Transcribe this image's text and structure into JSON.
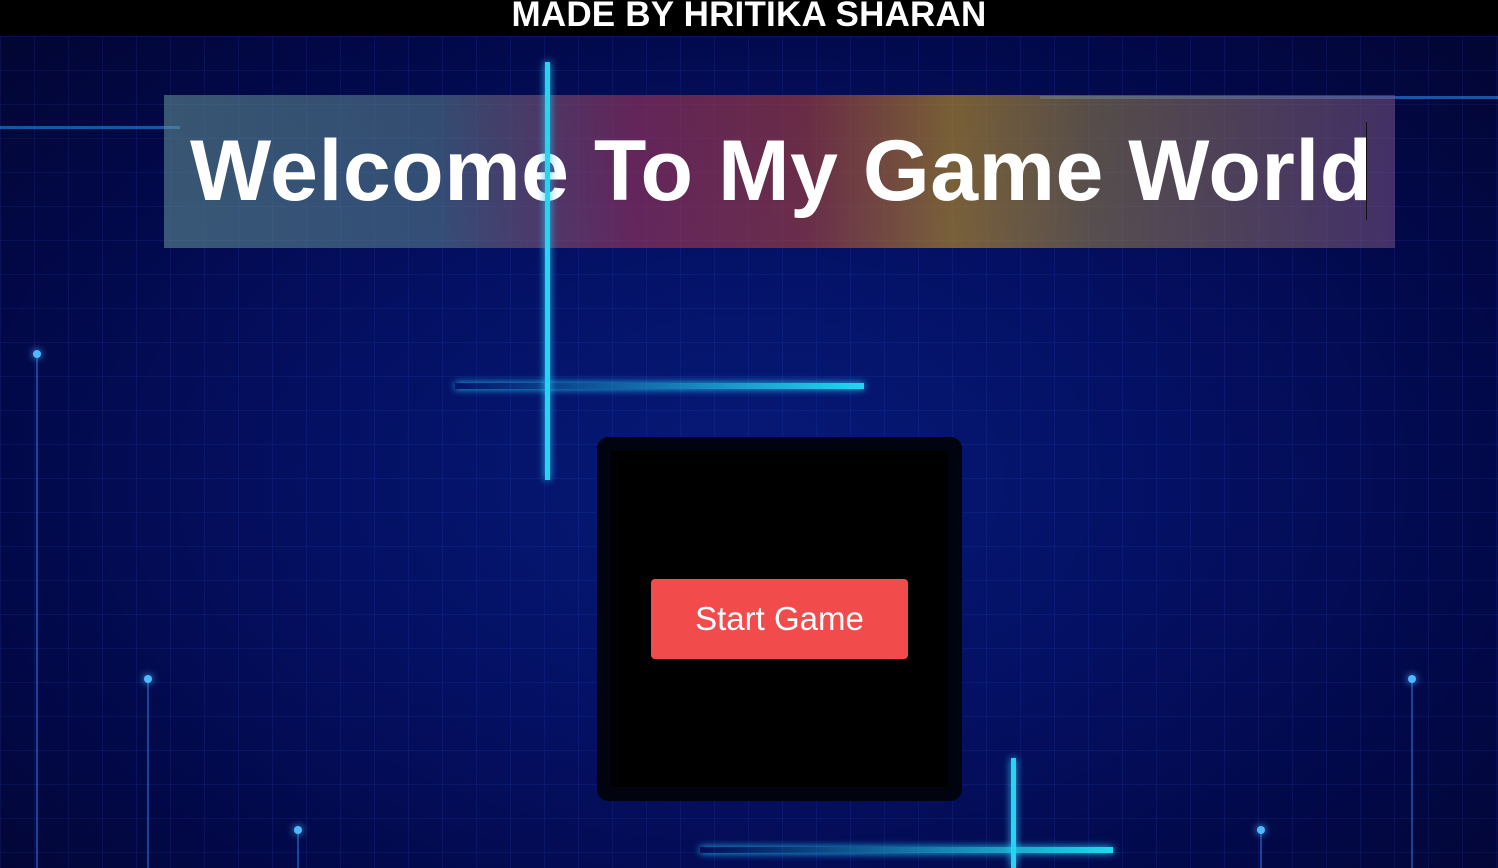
{
  "banner": {
    "text": "MADE BY HRITIKA SHARAN"
  },
  "title": {
    "text": "Welcome To My Game World"
  },
  "game": {
    "start_label": "Start Game"
  },
  "colors": {
    "background": "#041063",
    "neon": "#23d7f0",
    "button": "#f24b4b",
    "banner": "#000000"
  }
}
